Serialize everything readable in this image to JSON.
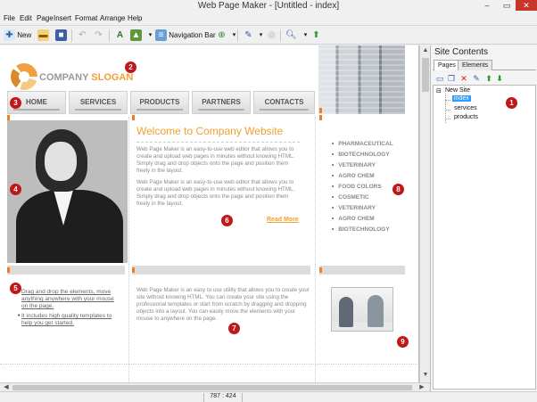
{
  "window": {
    "title": "Web Page Maker - [Untitled - index]",
    "min": "–",
    "max": "▭",
    "close": "✕"
  },
  "menu": [
    "File",
    "Edit",
    "Page",
    "Insert",
    "Format",
    "Arrange",
    "Help"
  ],
  "toolbar": {
    "new_label": "New",
    "navbar_label": "Navigation Bar"
  },
  "page": {
    "slogan_prefix": "COMPANY ",
    "slogan_accent": "SLOGAN",
    "nav": [
      "HOME",
      "SERVICES",
      "PRODUCTS",
      "PARTNERS",
      "CONTACTS"
    ],
    "welcome": "Welcome to Company Website",
    "para1": "Web Page Maker is an easy-to-use web editor that allows you to create and upload web pages in minutes without knowing HTML. Simply drag and drop objects onto the page and position them freely in the layout.",
    "para2": "Web Page Maker is an easy-to-use web editor that allows you to create and upload web pages in minutes without knowing HTML. Simply drag and drop objects onto the page and position them freely in the layout.",
    "read_more": "Read More",
    "right_list": [
      "PHARMACEUTICAL",
      "BIOTECHNOLOGY",
      "VETERINARY",
      "AGRO CHEM",
      "FOOD COLORS",
      "COSMETIC",
      "VETERINARY",
      "AGRO CHEM",
      "BIOTECHNOLOGY"
    ],
    "bullets": [
      "Drag and drop the elements, move anything anywhere with your mouse on the page.",
      "It includes high quality templates to help you get started."
    ],
    "para3": "Web Page Maker is an easy to use utility that allows you to create your site without knowing HTML. You can create your site using the professional templates or start from scratch by dragging and dropping objects into a layout. You can easily move the elements with your mouse to anywhere on the page."
  },
  "badges": [
    "1",
    "2",
    "3",
    "4",
    "5",
    "6",
    "7",
    "8",
    "9"
  ],
  "panel": {
    "title": "Site Contents",
    "tabs": [
      "Pages",
      "Elements"
    ],
    "tree": {
      "root": "New Site",
      "pages": [
        "index",
        "services",
        "products"
      ]
    }
  },
  "status": {
    "coords": "787 : 424"
  },
  "colors": {
    "accent": "#f0a030",
    "badge": "#c01818",
    "selection": "#3399ff"
  }
}
